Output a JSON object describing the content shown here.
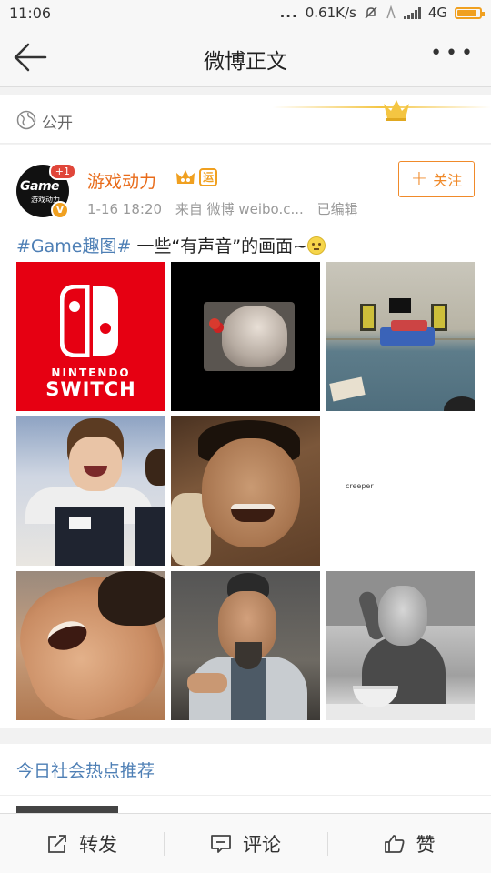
{
  "status_bar": {
    "time": "11:06",
    "dots": "...",
    "speed": "0.61K/s",
    "network": "4G"
  },
  "nav": {
    "title": "微博正文",
    "more": "•••"
  },
  "visibility": {
    "label": "公开"
  },
  "post": {
    "avatar_text": "Game",
    "avatar_subtext": "游戏动力",
    "avatar_badge": "+1",
    "verified_badge": "V",
    "username": "游戏动力",
    "yun_badge": "运",
    "time": "1-16 18:20",
    "source": "来自 微博 weibo.c...",
    "edited": "已编辑",
    "follow_label": "关注",
    "hashtag": "#Game趣图#",
    "content": " 一些“有声音”的画面~",
    "images": [
      {
        "kind": "switch",
        "line1": "NINTENDO",
        "line2": "SWITCH"
      },
      {
        "kind": "head"
      },
      {
        "kind": "room"
      },
      {
        "kind": "shop"
      },
      {
        "kind": "face"
      },
      {
        "kind": "creeper",
        "caption": "creeper"
      },
      {
        "kind": "yell"
      },
      {
        "kind": "period"
      },
      {
        "kind": "old"
      }
    ]
  },
  "hot": {
    "title": "今日社会热点推荐"
  },
  "toolbar": {
    "repost": "转发",
    "comment": "评论",
    "like": "赞"
  },
  "colors": {
    "accent_orange": "#f08a2a",
    "link_blue": "#4e7fb5",
    "username_orange": "#e86b1a",
    "switch_red": "#e60012"
  },
  "icons": [
    "back-arrow-icon",
    "more-dots-icon",
    "globe-icon",
    "crown-icon",
    "repost-icon",
    "comment-icon",
    "like-icon",
    "battery-icon",
    "signal-icon",
    "mute-icon"
  ]
}
